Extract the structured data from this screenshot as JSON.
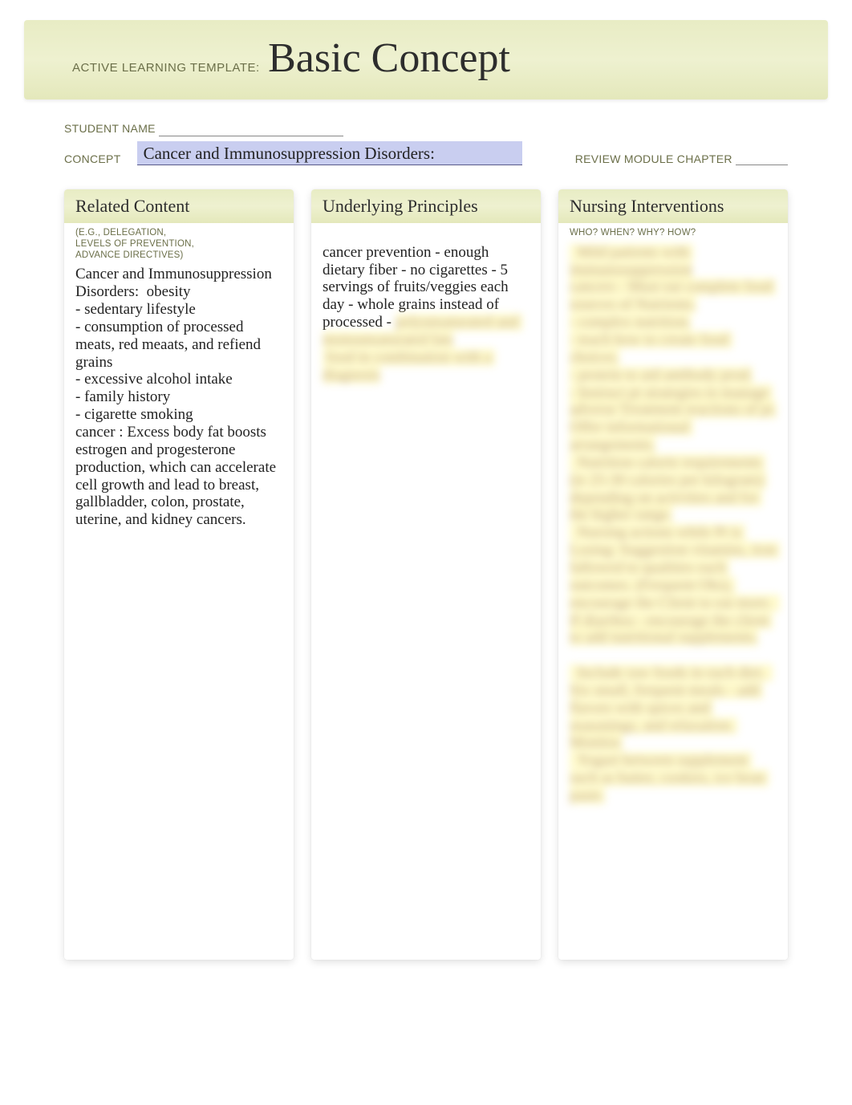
{
  "header": {
    "prefix": "ACTIVE LEARNING TEMPLATE:",
    "title": "Basic Concept"
  },
  "meta": {
    "student_name_label": "STUDENT NAME",
    "concept_label": "CONCEPT",
    "concept_value": "Cancer and Immunosuppression Disorders:",
    "review_label": "REVIEW MODULE CHAPTER"
  },
  "cards": {
    "related": {
      "heading": "Related Content",
      "subnote": "(E.G., DELEGATION,\nLEVELS OF PREVENTION,\nADVANCE DIRECTIVES)",
      "body": "Cancer and Immunosuppression Disorders:  obesity\n- sedentary lifestyle\n- consumption of processed meats, red meaats, and refiend grains\n- excessive alcohol intake\n- family history\n- cigarette smoking\ncancer : Excess body fat boosts estrogen and progesterone production, which can accelerate cell growth and lead to breast, gallbladder, colon, prostate, uterine, and kidney cancers."
    },
    "principles": {
      "heading": "Underlying Principles",
      "body_visible": "cancer prevention - enough dietary fiber - no cigarettes - 5 servings of fruits/veggies each day - whole grains instead of processed - ",
      "body_blurred": "polyunsaturated and monounsaturated fats\n food in combination with a diagnosis"
    },
    "nursing": {
      "heading": "Nursing Interventions",
      "subnote": "WHO? WHEN? WHY? HOW?",
      "body_blurred": "  Mild patients with immunosuppression\ncancers - Must eat complete food sources of Nutrients.\n- complex nutrition.\n- teach how to create food choices.\n- protein to aid antibody prod.\n- Instruct pt strategies to manage adverse Treatment reactions of pt.\nOffer informational arrangements.\n  Nutrition calorie requirements (ie 25-30 calories per kilogram) depending on activities and for the higher range.\n  Nursing actions while Pt is Losing: Suggestion vitamins, iron fallowed to qualities each outcomes. (Frequent Obs), encourage the Client to eat more.  If diarrhea - encourage the client to add nutritional supplements.\n\n  Include raw foods in each diet.  Six small, frequent meals - add flavors with spices and seasonings, and relaxation. Monitor.\n  Yogurt between supplement such as butter, cookies, ice bean paste."
    }
  }
}
